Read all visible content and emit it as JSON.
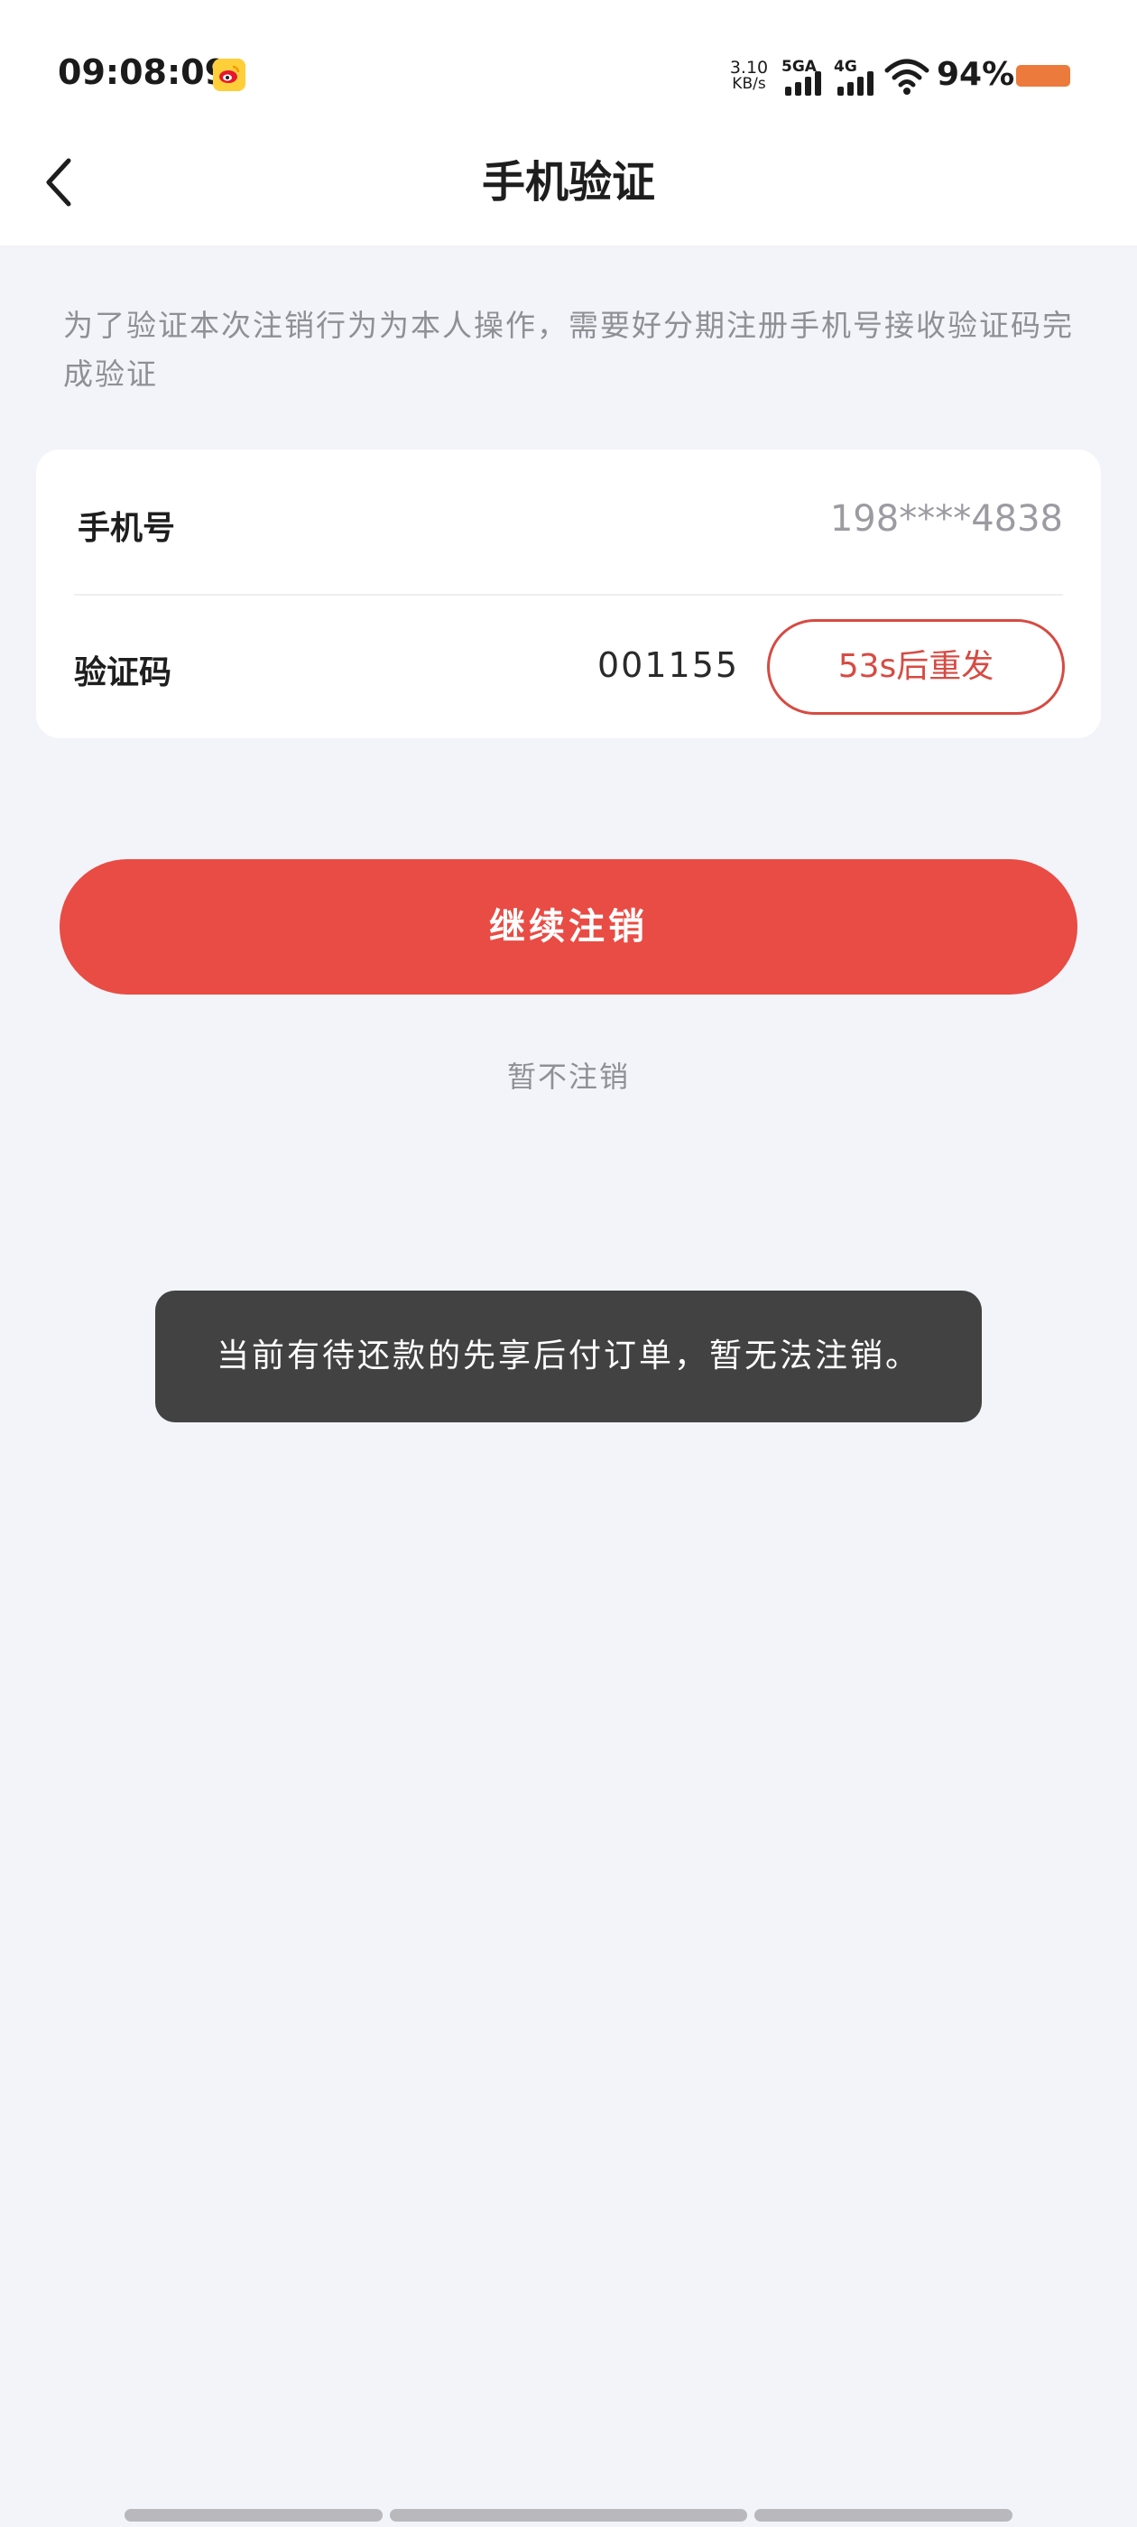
{
  "status_bar": {
    "time": "09:08:09",
    "app_icon": "weibo-icon",
    "speed_value": "3.10",
    "speed_unit": "KB/s",
    "network_1": "5GA",
    "network_2": "4G",
    "battery_percent": "94%",
    "battery_color": "#ec7a3c"
  },
  "header": {
    "title": "手机验证",
    "back_icon": "chevron-left-icon"
  },
  "notice": "为了验证本次注销行为为本人操作，需要好分期注册手机号接收验证码完成验证",
  "form": {
    "phone_label": "手机号",
    "phone_value": "198****4838",
    "code_label": "验证码",
    "code_value": "001155",
    "resend_label": "53s后重发"
  },
  "actions": {
    "continue_label": "继续注销",
    "cancel_label": "暂不注销"
  },
  "toast": "当前有待还款的先享后付订单，暂无法注销。",
  "colors": {
    "primary": "#e84c44",
    "resend": "#d64b43",
    "background": "#f3f4f9"
  }
}
